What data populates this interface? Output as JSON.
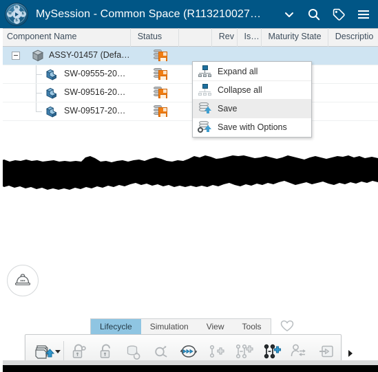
{
  "titlebar": {
    "app_icon": "compass-icon",
    "title": "MySession - Common Space (R113210027…",
    "chevron_icon": "chevron-down-icon",
    "search_icon": "search-icon",
    "tag_icon": "tag-icon",
    "menu_icon": "hamburger-menu-icon",
    "background_color": "#015686",
    "text_color": "#ffffff"
  },
  "columns": [
    {
      "key": "name",
      "label": "Component Name"
    },
    {
      "key": "status",
      "label": "Status"
    },
    {
      "key": "blank",
      "label": ""
    },
    {
      "key": "rev",
      "label": "Rev"
    },
    {
      "key": "is",
      "label": "Is…"
    },
    {
      "key": "maturity",
      "label": "Maturity State"
    },
    {
      "key": "desc",
      "label": "Descriptio"
    }
  ],
  "tree": {
    "rows": [
      {
        "label": "ASSY-01457 (Defa…",
        "level": 0,
        "selected": true,
        "expanded": true,
        "icon": "assembly-cube-icon",
        "status_icon": "database-save-pending-icon"
      },
      {
        "label": "SW-09555-20…",
        "level": 1,
        "selected": false,
        "icon": "part-icon",
        "status_icon": "database-save-pending-icon"
      },
      {
        "label": "SW-09516-20…",
        "level": 1,
        "selected": false,
        "icon": "part-icon",
        "status_icon": "database-save-pending-icon"
      },
      {
        "label": "SW-09517-20…",
        "level": 1,
        "selected": false,
        "icon": "part-icon",
        "status_icon": "database-save-pending-icon"
      }
    ],
    "selection_color": "#cfe4f2"
  },
  "context_menu": {
    "items": [
      {
        "label": "Expand all",
        "icon": "expand-all-icon",
        "hovered": false
      },
      {
        "label": "Collapse all",
        "icon": "collapse-all-icon",
        "hovered": false
      },
      {
        "label": "Save",
        "icon": "save-icon",
        "hovered": true
      },
      {
        "label": "Save with Options",
        "icon": "save-with-options-icon",
        "hovered": false
      }
    ],
    "hover_color": "#ececec"
  },
  "viewport": {
    "helmet_badge_icon": "safety-helmet-icon"
  },
  "tabstrip": {
    "tabs": [
      {
        "label": "Lifecycle",
        "active": true
      },
      {
        "label": "Simulation",
        "active": false
      },
      {
        "label": "View",
        "active": false
      },
      {
        "label": "Tools",
        "active": false
      }
    ],
    "active_color": "#8fc5e2",
    "favorite_icon": "heart-outline-icon"
  },
  "actionbar": {
    "buttons": [
      {
        "name": "save-stack-button",
        "icon": "save-stack-icon",
        "has_caret": true,
        "enabled": true
      },
      {
        "name": "lock-button",
        "icon": "lock-icon",
        "has_caret": false,
        "enabled": false
      },
      {
        "name": "unlock-button",
        "icon": "unlock-icon",
        "has_caret": false,
        "enabled": false
      },
      {
        "name": "refresh-database-button",
        "icon": "database-refresh-icon",
        "has_caret": false,
        "enabled": false
      },
      {
        "name": "search-relations-button",
        "icon": "search-relations-icon",
        "has_caret": false,
        "enabled": false
      },
      {
        "name": "propagate-button",
        "icon": "propagate-cycle-icon",
        "has_caret": false,
        "enabled": true
      },
      {
        "name": "new-revision-button",
        "icon": "add-node-icon",
        "has_caret": false,
        "enabled": false
      },
      {
        "name": "new-branch-button",
        "icon": "add-branch-icon",
        "has_caret": false,
        "enabled": false
      },
      {
        "name": "add-structure-button",
        "icon": "add-structure-icon",
        "has_caret": false,
        "enabled": true
      },
      {
        "name": "change-owner-button",
        "icon": "transfer-owner-icon",
        "has_caret": false,
        "enabled": false
      },
      {
        "name": "export-button",
        "icon": "export-arrow-icon",
        "has_caret": false,
        "enabled": false
      }
    ],
    "overflow_icon": "overflow-arrow-icon"
  }
}
